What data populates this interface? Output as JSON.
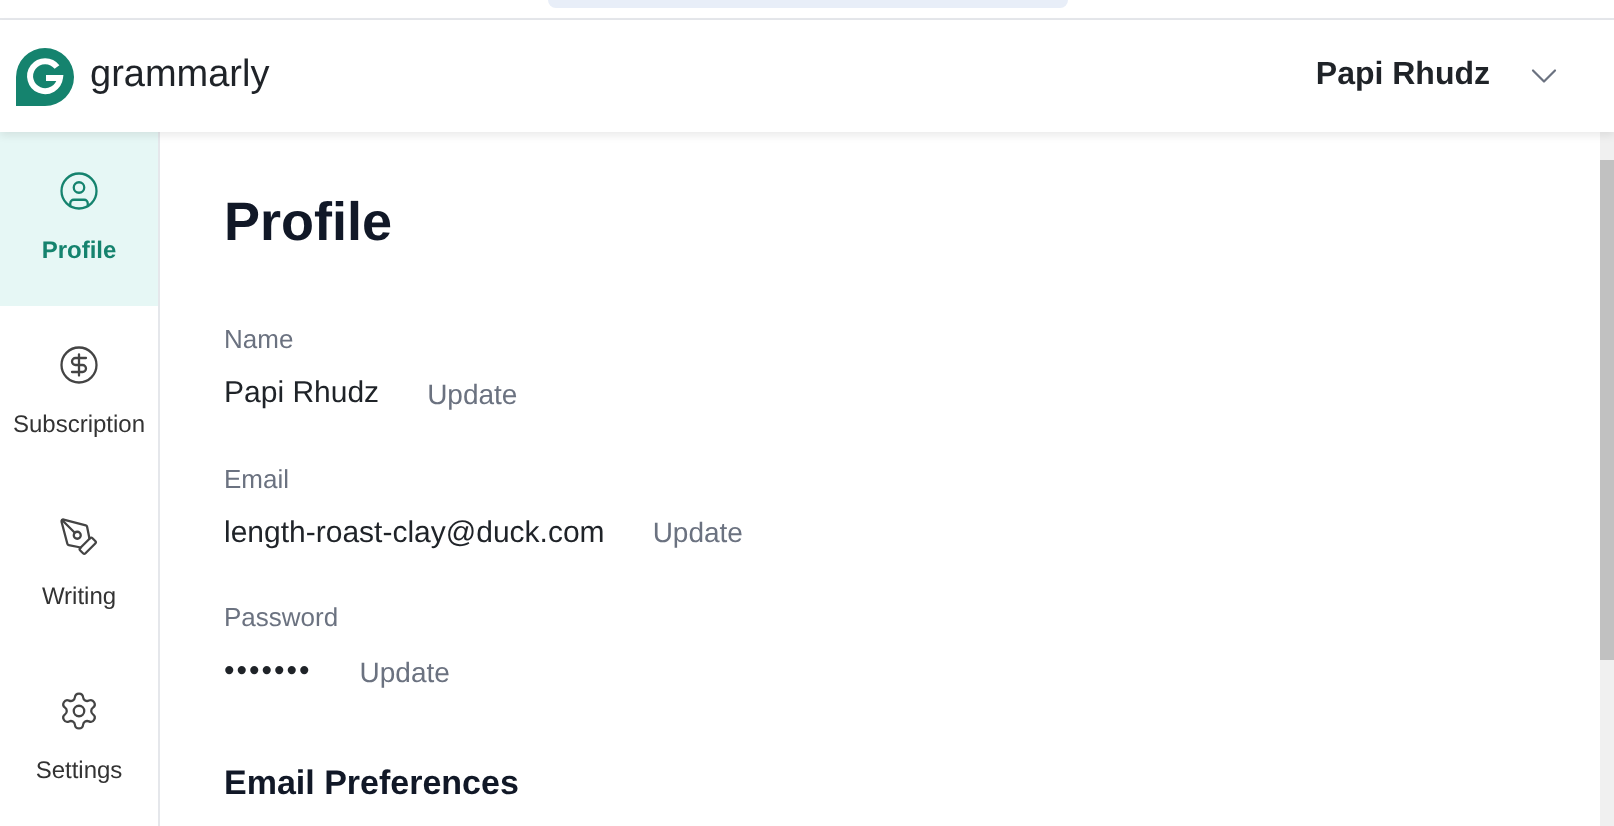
{
  "brand": {
    "name": "grammarly"
  },
  "user_menu": {
    "name": "Papi Rhudz"
  },
  "sidebar": {
    "items": [
      {
        "label": "Profile",
        "selected": true
      },
      {
        "label": "Subscription",
        "selected": false
      },
      {
        "label": "Writing",
        "selected": false
      },
      {
        "label": "Settings",
        "selected": false
      }
    ]
  },
  "page": {
    "title": "Profile",
    "fields": [
      {
        "label": "Name",
        "value": "Papi Rhudz",
        "action": "Update",
        "kind": "text"
      },
      {
        "label": "Email",
        "value": "length-roast-clay@duck.com",
        "action": "Update",
        "kind": "text"
      },
      {
        "label": "Password",
        "value": "•••••••",
        "action": "Update",
        "kind": "secret"
      }
    ],
    "next_section": "Email Preferences"
  }
}
